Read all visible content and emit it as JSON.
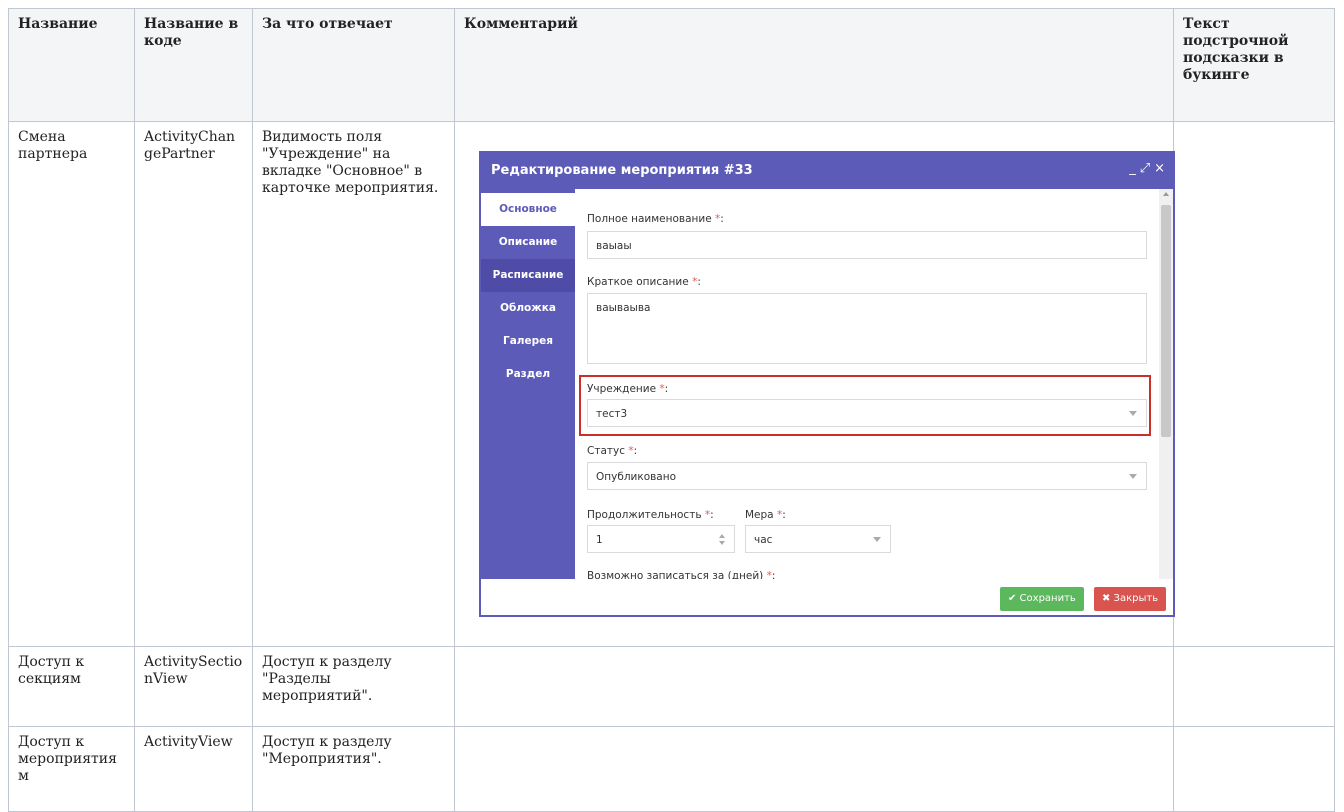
{
  "table": {
    "headers": [
      "Название",
      "Название в коде",
      "За что отвечает",
      "Комментарий",
      "Текст подстрочной подсказки в букинге"
    ],
    "rows": [
      {
        "name": "Смена партнера",
        "code": "ActivityChangePartner",
        "purpose": "Видимость поля \"Учреждение\" на вкладке \"Основное\" в карточке мероприятия.",
        "comment": "",
        "hint": ""
      },
      {
        "name": "Доступ к секциям",
        "code": "ActivitySectionView",
        "purpose": "Доступ к разделу \"Разделы мероприятий\".",
        "comment": "",
        "hint": ""
      },
      {
        "name": "Доступ к мероприятиям",
        "code": "ActivityView",
        "purpose": "Доступ к разделу \"Мероприятия\".",
        "comment": "",
        "hint": ""
      }
    ]
  },
  "dialog": {
    "title": "Редактирование мероприятия #33",
    "controls": [
      "_",
      "⤢",
      "×"
    ],
    "tabs": [
      "Основное",
      "Описание",
      "Расписание",
      "Обложка",
      "Галерея",
      "Раздел"
    ],
    "active_tab": "Основное",
    "fields": {
      "full_name_label": "Полное наименование",
      "full_name_value": "ваыаы",
      "short_desc_label": "Краткое описание",
      "short_desc_value": "ваываыва",
      "institution_label": "Учреждение",
      "institution_value": "тест3",
      "status_label": "Статус",
      "status_value": "Опубликовано",
      "duration_label": "Продолжительность",
      "duration_value": "1",
      "measure_label": "Мера",
      "measure_value": "час",
      "days_label": "Возможно записаться за (дней)",
      "required_mark": "*",
      "colon": ":"
    },
    "buttons": {
      "save": "✔ Сохранить",
      "close": "✖ Закрыть"
    },
    "colors": {
      "header": "#5d5bb8",
      "save": "#5cb85c",
      "close": "#d9534f",
      "highlight": "#c9302c"
    }
  }
}
